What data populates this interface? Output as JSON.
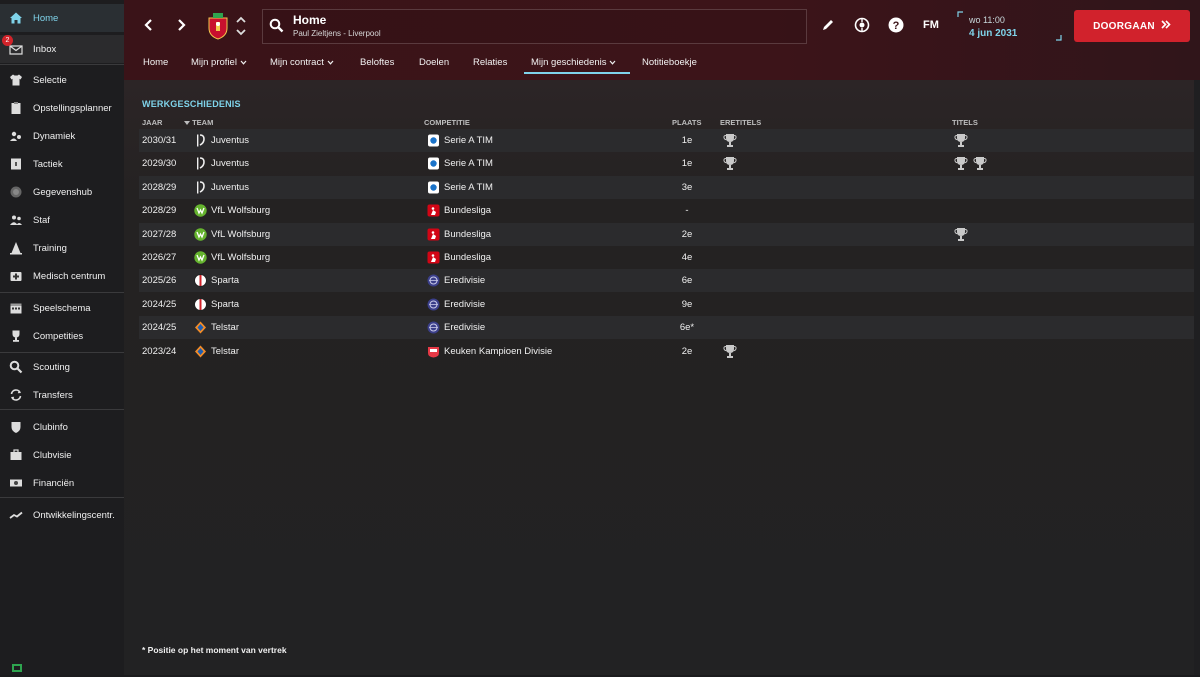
{
  "sidebar": {
    "items": [
      {
        "label": "Home",
        "icon": "home-icon"
      },
      {
        "label": "Inbox",
        "icon": "inbox-icon",
        "badge": "2"
      },
      {
        "label": "Selectie",
        "icon": "shirt-icon"
      },
      {
        "label": "Opstellingsplanner",
        "icon": "clipboard-icon"
      },
      {
        "label": "Dynamiek",
        "icon": "people-icon"
      },
      {
        "label": "Tactiek",
        "icon": "board-icon"
      },
      {
        "label": "Gegevenshub",
        "icon": "data-icon"
      },
      {
        "label": "Staf",
        "icon": "staff-icon"
      },
      {
        "label": "Training",
        "icon": "cone-icon"
      },
      {
        "label": "Medisch centrum",
        "icon": "medical-icon"
      },
      {
        "label": "Speelschema",
        "icon": "calendar-icon"
      },
      {
        "label": "Competities",
        "icon": "trophy-icon"
      },
      {
        "label": "Scouting",
        "icon": "search-icon"
      },
      {
        "label": "Transfers",
        "icon": "transfer-icon"
      },
      {
        "label": "Clubinfo",
        "icon": "shield-icon"
      },
      {
        "label": "Clubvisie",
        "icon": "briefcase-icon"
      },
      {
        "label": "Financiën",
        "icon": "money-icon"
      },
      {
        "label": "Ontwikkelingscentr.",
        "icon": "development-icon"
      }
    ]
  },
  "header": {
    "title": "Home",
    "subtitle": "Paul Zieltjens - Liverpool",
    "date_time": "wo 11:00",
    "date_day": "4 jun 2031",
    "continue_label": "DOORGAAN",
    "fm_label": "FM",
    "help_label": "?"
  },
  "tabs": [
    {
      "label": "Home"
    },
    {
      "label": "Mijn profiel"
    },
    {
      "label": "Mijn contract"
    },
    {
      "label": "Beloftes"
    },
    {
      "label": "Doelen"
    },
    {
      "label": "Relaties"
    },
    {
      "label": "Mijn geschiedenis"
    },
    {
      "label": "Notitieboekje"
    }
  ],
  "main": {
    "section_title": "WERKGESCHIEDENIS",
    "columns": {
      "year": "JAAR",
      "team": "TEAM",
      "competition": "COMPETITIE",
      "position": "PLAATS",
      "honours": "ERETITELS",
      "titles": "TITELS"
    },
    "footnote": "* Positie op het moment van vertrek"
  },
  "history": [
    {
      "year": "2030/31",
      "team": "Juventus",
      "team_logo": "juventus-logo",
      "competition": "Serie A TIM",
      "comp_logo": "serie-a-logo",
      "position": "1e",
      "honours": 1,
      "titles": 1
    },
    {
      "year": "2029/30",
      "team": "Juventus",
      "team_logo": "juventus-logo",
      "competition": "Serie A TIM",
      "comp_logo": "serie-a-logo",
      "position": "1e",
      "honours": 1,
      "titles": 2
    },
    {
      "year": "2028/29",
      "team": "Juventus",
      "team_logo": "juventus-logo",
      "competition": "Serie A TIM",
      "comp_logo": "serie-a-logo",
      "position": "3e",
      "honours": 0,
      "titles": 0
    },
    {
      "year": "2028/29",
      "team": "VfL Wolfsburg",
      "team_logo": "wolfsburg-logo",
      "competition": "Bundesliga",
      "comp_logo": "bundesliga-logo",
      "position": "-",
      "honours": 0,
      "titles": 0
    },
    {
      "year": "2027/28",
      "team": "VfL Wolfsburg",
      "team_logo": "wolfsburg-logo",
      "competition": "Bundesliga",
      "comp_logo": "bundesliga-logo",
      "position": "2e",
      "honours": 0,
      "titles": 1
    },
    {
      "year": "2026/27",
      "team": "VfL Wolfsburg",
      "team_logo": "wolfsburg-logo",
      "competition": "Bundesliga",
      "comp_logo": "bundesliga-logo",
      "position": "4e",
      "honours": 0,
      "titles": 0
    },
    {
      "year": "2025/26",
      "team": "Sparta",
      "team_logo": "sparta-logo",
      "competition": "Eredivisie",
      "comp_logo": "eredivisie-logo",
      "position": "6e",
      "honours": 0,
      "titles": 0
    },
    {
      "year": "2024/25",
      "team": "Sparta",
      "team_logo": "sparta-logo",
      "competition": "Eredivisie",
      "comp_logo": "eredivisie-logo",
      "position": "9e",
      "honours": 0,
      "titles": 0
    },
    {
      "year": "2024/25",
      "team": "Telstar",
      "team_logo": "telstar-logo",
      "competition": "Eredivisie",
      "comp_logo": "eredivisie-logo",
      "position": "6e*",
      "honours": 0,
      "titles": 0
    },
    {
      "year": "2023/24",
      "team": "Telstar",
      "team_logo": "telstar-logo",
      "competition": "Keuken Kampioen Divisie",
      "comp_logo": "kkd-logo",
      "position": "2e",
      "honours": 1,
      "titles": 0
    }
  ],
  "colors": {
    "accent": "#7fd3ea",
    "brand_red": "#d1222c",
    "header_bg": "#3a1318"
  }
}
